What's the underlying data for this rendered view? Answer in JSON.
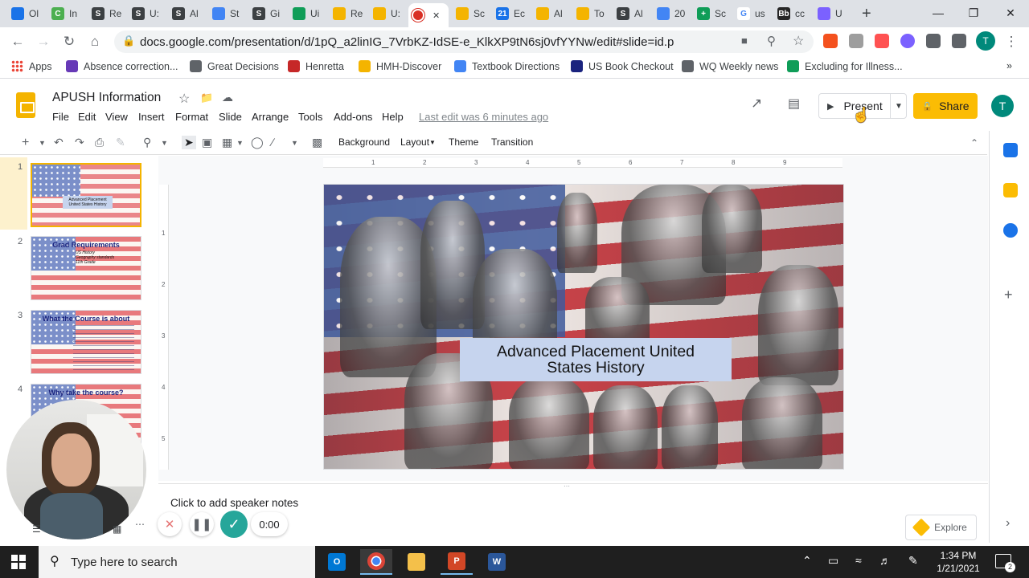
{
  "browser": {
    "tabs": [
      {
        "title": "Ol",
        "color": "#1a73e8",
        "glyph": ""
      },
      {
        "title": "In",
        "color": "#4caf50",
        "glyph": "C"
      },
      {
        "title": "Re",
        "color": "#3c4043",
        "glyph": "S"
      },
      {
        "title": "U:",
        "color": "#3c4043",
        "glyph": "S"
      },
      {
        "title": "Al",
        "color": "#3c4043",
        "glyph": "S"
      },
      {
        "title": "St",
        "color": "#4285f4",
        "glyph": ""
      },
      {
        "title": "Gi",
        "color": "#3c4043",
        "glyph": "S"
      },
      {
        "title": "Ui",
        "color": "#0f9d58",
        "glyph": ""
      },
      {
        "title": "Re",
        "color": "#f4b400",
        "glyph": ""
      },
      {
        "title": "U:",
        "color": "#f4b400",
        "glyph": ""
      },
      {
        "title": "",
        "color": "#d93025",
        "glyph": "",
        "active": true
      },
      {
        "title": "Sc",
        "color": "#f4b400",
        "glyph": ""
      },
      {
        "title": "Ec",
        "color": "#1a73e8",
        "glyph": "21"
      },
      {
        "title": "Al",
        "color": "#f4b400",
        "glyph": ""
      },
      {
        "title": "To",
        "color": "#f4b400",
        "glyph": ""
      },
      {
        "title": "Al",
        "color": "#3c4043",
        "glyph": "S"
      },
      {
        "title": "20",
        "color": "#4285f4",
        "glyph": ""
      },
      {
        "title": "Sc",
        "color": "#0f9d58",
        "glyph": "+"
      },
      {
        "title": "us",
        "color": "#ffffff",
        "glyph": "G"
      },
      {
        "title": "cc",
        "color": "#262626",
        "glyph": "Bb"
      },
      {
        "title": "U",
        "color": "#7b61ff",
        "glyph": ""
      }
    ],
    "new_tab": "+",
    "url": "docs.google.com/presentation/d/1pQ_a2linIG_7VrbKZ-IdSE-e_KlkXP9tN6sj0vfYYNw/edit#slide=id.p",
    "profile_initial": "T",
    "bookmarks": [
      {
        "label": "Apps",
        "color": "#4285f4"
      },
      {
        "label": "Absence correction...",
        "color": "#673ab7"
      },
      {
        "label": "Great Decisions",
        "color": "#5f6368"
      },
      {
        "label": "Henretta",
        "color": "#c62828"
      },
      {
        "label": "HMH-Discover",
        "color": "#f4b400"
      },
      {
        "label": "Textbook Directions",
        "color": "#4285f4"
      },
      {
        "label": "US Book Checkout",
        "color": "#1a237e"
      },
      {
        "label": "WQ Weekly news",
        "color": "#5f6368"
      },
      {
        "label": "Excluding for Illness...",
        "color": "#0f9d58"
      }
    ],
    "bookmarks_more": "»"
  },
  "slides_app": {
    "doc_title": "APUSH Information",
    "menus": [
      "File",
      "Edit",
      "View",
      "Insert",
      "Format",
      "Slide",
      "Arrange",
      "Tools",
      "Add-ons",
      "Help"
    ],
    "last_edit": "Last edit was 6 minutes ago",
    "present_label": "Present",
    "share_label": "Share",
    "user_initial": "T",
    "toolbar": {
      "background": "Background",
      "layout": "Layout",
      "theme": "Theme",
      "transition": "Transition"
    },
    "ruler_h": [
      "1",
      "2",
      "3",
      "4",
      "5",
      "6",
      "7",
      "8",
      "9"
    ],
    "ruler_v": [
      "1",
      "2",
      "3",
      "4",
      "5"
    ],
    "slides": [
      {
        "number": "1",
        "title": "Advanced Placement United States History",
        "bullets": []
      },
      {
        "number": "2",
        "title": "Grad Requirements",
        "bullets": [
          "US History",
          "Geography standards",
          "11th Grade"
        ]
      },
      {
        "number": "3",
        "title": "What the Course is about",
        "bullets": []
      },
      {
        "number": "4",
        "title": "Why take the course?",
        "bullets": []
      }
    ],
    "current_slide": {
      "title_line1": "Advanced Placement United",
      "title_line2": "States History"
    },
    "speaker_notes_placeholder": "Click to add speaker notes",
    "explore_label": "Explore"
  },
  "recorder": {
    "timer": "0:00"
  },
  "taskbar": {
    "search_placeholder": "Type here to search",
    "time": "1:34 PM",
    "date": "1/21/2021",
    "notification_count": "2"
  }
}
